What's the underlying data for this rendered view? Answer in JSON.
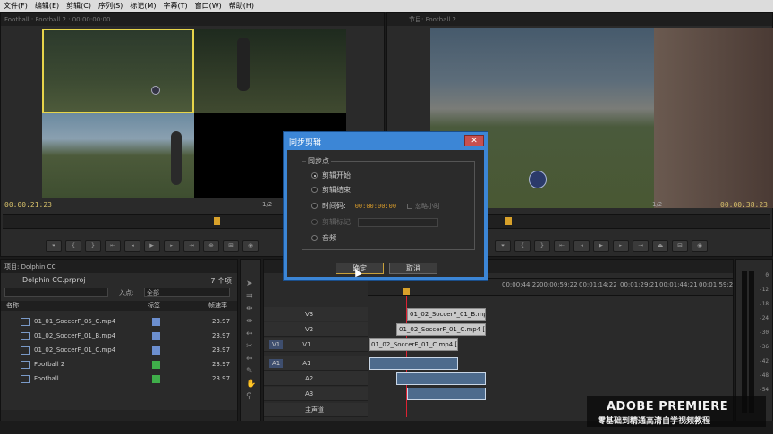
{
  "menu": [
    "文件(F)",
    "编辑(E)",
    "剪辑(C)",
    "序列(S)",
    "标记(M)",
    "字幕(T)",
    "窗口(W)",
    "帮助(H)"
  ],
  "source_monitor": {
    "tab": "Football : Football 2 : 00:00:00:00",
    "timecode_left": "00:00:21:23",
    "fit": "1/2"
  },
  "program_monitor": {
    "tab": "节目: Football 2",
    "timecode_right": "00:00:38:23",
    "fit": "1/2"
  },
  "project": {
    "tab": "项目: Dolphin CC",
    "filename": "Dolphin CC.prproj",
    "count": "7 个项",
    "in_label": "入点:",
    "in_value": "全部",
    "col_name": "名称",
    "col_label": "标签",
    "col_fps": "帧速率",
    "items": [
      {
        "name": "01_01_SoccerF_05_C.mp4",
        "color": "#6c8fcf",
        "fps": "23.97"
      },
      {
        "name": "01_02_SoccerF_01_B.mp4",
        "color": "#6c8fcf",
        "fps": "23.97"
      },
      {
        "name": "01_02_SoccerF_01_C.mp4",
        "color": "#6c8fcf",
        "fps": "23.97"
      },
      {
        "name": "Football 2",
        "color": "#3fae4a",
        "fps": "23.97"
      },
      {
        "name": "Football",
        "color": "#3fae4a",
        "fps": "23.97"
      }
    ]
  },
  "timeline": {
    "ruler": [
      "00:00:44:22",
      "00:00:59:22",
      "00:01:14:22",
      "00:01:29:21",
      "00:01:44:21",
      "00:01:59:2"
    ],
    "tracks": [
      "V3",
      "V2",
      "V1",
      "A1",
      "A2",
      "A3"
    ],
    "source_v": "V1",
    "source_a": "A1",
    "clips": {
      "v3": "01_02_SoccerF_01_B.mp",
      "v2": "01_02_SoccerF_01_C.mp4 [V",
      "v1": "01_02_SoccerF_01_C.mp4 [V"
    },
    "master": "主声道"
  },
  "meter_scale": [
    "0",
    "-12",
    "-18",
    "-24",
    "-30",
    "-36",
    "-42",
    "-48",
    "-54"
  ],
  "dialog": {
    "title": "同步剪辑",
    "group": "同步点",
    "options": [
      "剪辑开始",
      "剪辑结束",
      "时间码:",
      "剪辑标记",
      "音频"
    ],
    "timecode": "00:00:00:00",
    "ignore_hours": "忽略小时",
    "ok": "确定",
    "cancel": "取消",
    "close": "✕"
  },
  "watermark": {
    "line1": "ADOBE PREMIERE",
    "line2": "零基础到精通高清自学视频教程"
  }
}
